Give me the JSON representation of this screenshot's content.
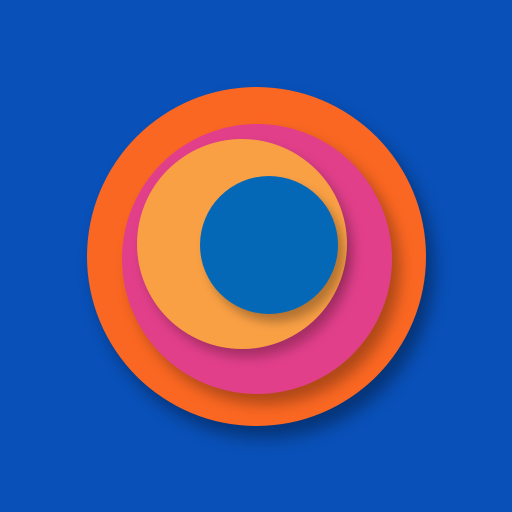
{
  "colors": {
    "background": "#0950B8",
    "outer_ring": "#FA6722",
    "middle_ring": "#E23F8B",
    "inner_ring": "#F9A045",
    "core": "#0568B7"
  },
  "icon": {
    "name": "concentric-circles-icon"
  }
}
